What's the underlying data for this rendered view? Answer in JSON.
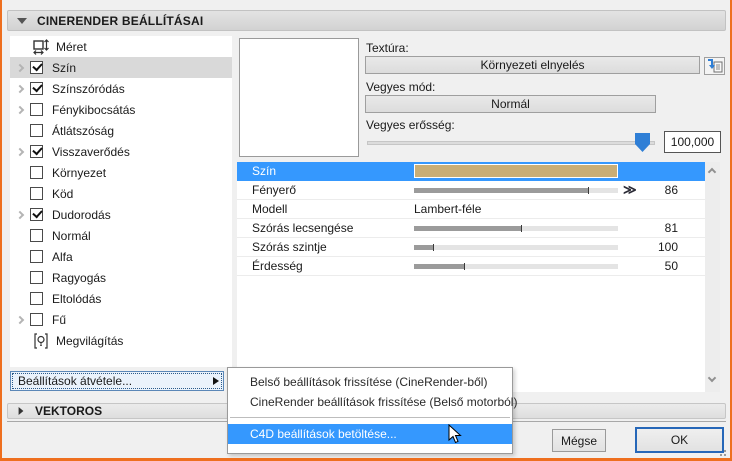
{
  "header": {
    "title": "CINERENDER BEÁLLÍTÁSAI"
  },
  "tree": {
    "items": [
      {
        "label": "Méret",
        "icon": "size-icon",
        "checkbox": null,
        "expand": false,
        "selected": false
      },
      {
        "label": "Szín",
        "icon": null,
        "checkbox": true,
        "expand": true,
        "selected": true
      },
      {
        "label": "Színszóródás",
        "icon": null,
        "checkbox": true,
        "expand": true,
        "selected": false
      },
      {
        "label": "Fénykibocsátás",
        "icon": null,
        "checkbox": false,
        "expand": true,
        "selected": false
      },
      {
        "label": "Átlátszóság",
        "icon": null,
        "checkbox": false,
        "expand": false,
        "selected": false
      },
      {
        "label": "Visszaverődés",
        "icon": null,
        "checkbox": true,
        "expand": true,
        "selected": false
      },
      {
        "label": "Környezet",
        "icon": null,
        "checkbox": false,
        "expand": false,
        "selected": false
      },
      {
        "label": "Köd",
        "icon": null,
        "checkbox": false,
        "expand": false,
        "selected": false
      },
      {
        "label": "Dudorodás",
        "icon": null,
        "checkbox": true,
        "expand": true,
        "selected": false
      },
      {
        "label": "Normál",
        "icon": null,
        "checkbox": false,
        "expand": false,
        "selected": false
      },
      {
        "label": "Alfa",
        "icon": null,
        "checkbox": false,
        "expand": false,
        "selected": false
      },
      {
        "label": "Ragyogás",
        "icon": null,
        "checkbox": false,
        "expand": false,
        "selected": false
      },
      {
        "label": "Eltolódás",
        "icon": null,
        "checkbox": false,
        "expand": false,
        "selected": false
      },
      {
        "label": "Fű",
        "icon": null,
        "checkbox": false,
        "expand": true,
        "selected": false
      },
      {
        "label": "Megvilágítás",
        "icon": "bulb-icon",
        "checkbox": null,
        "expand": false,
        "selected": false
      }
    ]
  },
  "texture_panel": {
    "texture_label": "Textúra:",
    "texture_button": "Környezeti elnyelés",
    "browse_icon": "texture-browse-icon",
    "blend_mode_label": "Vegyes mód:",
    "blend_mode_button": "Normál",
    "blend_strength_label": "Vegyes erősség:",
    "blend_strength_value": "100,000",
    "blend_strength_percent": 100
  },
  "properties": {
    "rows": [
      {
        "label": "Szín",
        "type": "color",
        "swatch_color": "#c9ae76",
        "selected": true
      },
      {
        "label": "Fényerő",
        "type": "slider",
        "value": "86",
        "fill_percent": 86,
        "has_link_glyph": true
      },
      {
        "label": "Modell",
        "type": "text",
        "value": "Lambert-féle"
      },
      {
        "label": "Szórás lecsengése",
        "type": "slider",
        "value": "81",
        "fill_percent": 53
      },
      {
        "label": "Szórás szintje",
        "type": "slider",
        "value": "100",
        "fill_percent": 10
      },
      {
        "label": "Érdesség",
        "type": "slider",
        "value": "50",
        "fill_percent": 25
      }
    ]
  },
  "transfer": {
    "label": "Beállítások átvétele..."
  },
  "menu": {
    "items": [
      {
        "type": "item",
        "label": "Belső beállítások frissítése (CineRender-ből)",
        "highlighted": false
      },
      {
        "type": "item",
        "label": "CineRender beállítások frissítése (Belső motorból)",
        "highlighted": false
      },
      {
        "type": "separator"
      },
      {
        "type": "item",
        "label": "C4D beállítások betöltése...",
        "highlighted": true
      }
    ]
  },
  "vectors": {
    "title": "VEKTOROS"
  },
  "footer": {
    "cancel_label": "Mégse",
    "ok_label": "OK"
  },
  "colors": {
    "accent_blue": "#3598fe",
    "frame_orange": "#ee6f1f",
    "color_swatch": "#c9ae76",
    "slider_handle_blue": "#2f7fd6"
  }
}
